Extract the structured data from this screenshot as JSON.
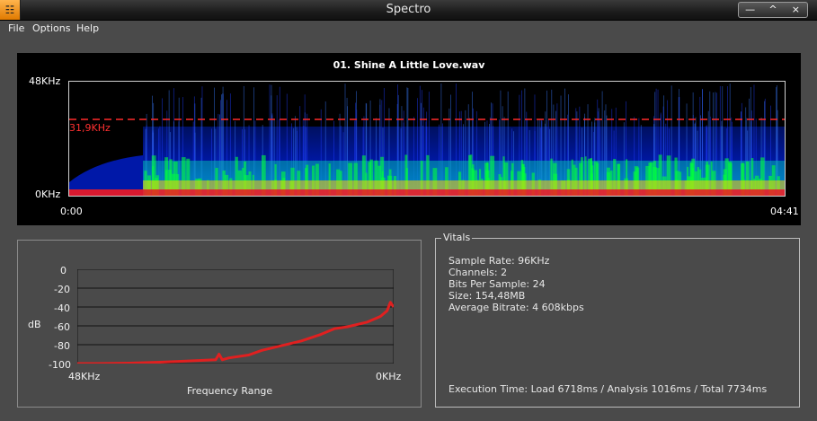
{
  "window": {
    "title": "Spectro",
    "icon": "app-icon",
    "buttons": {
      "minimize": "—",
      "maximize": "^",
      "close": "×"
    }
  },
  "menu": {
    "file": "File",
    "options": "Options",
    "help": "Help"
  },
  "spectrogram": {
    "file_name": "01. Shine A Little Love.wav",
    "freq_top": "48KHz",
    "freq_bottom": "0KHz",
    "cutoff_label": "31,9KHz",
    "time_start": "0:00",
    "time_end": "04:41",
    "colors": {
      "cutoff": "#ff2a2a",
      "low": "#0018a8",
      "mid": "#00ff3c",
      "high": "#ffd000",
      "peak": "#ff1a1a"
    }
  },
  "chart_data": {
    "type": "line",
    "xlabel": "Frequency Range",
    "ylabel": "dB",
    "x_tick_labels": [
      "48KHz",
      "0KHz"
    ],
    "y_ticks": [
      0,
      -20,
      -40,
      -60,
      -80,
      -100
    ],
    "ylim": [
      -100,
      0
    ],
    "xlim": [
      48,
      0
    ],
    "grid": true,
    "series": [
      {
        "color": "#e02020",
        "x": [
          48,
          45,
          40,
          35,
          30,
          27,
          26.5,
          26,
          25,
          22,
          20,
          17,
          14,
          11,
          9,
          7,
          4,
          2,
          1,
          0.5,
          0
        ],
        "y": [
          -100,
          -100,
          -99.5,
          -98.5,
          -97,
          -96,
          -90,
          -96,
          -94,
          -91,
          -86,
          -81,
          -76,
          -69,
          -63,
          -61,
          -56,
          -50,
          -44,
          -35,
          -40
        ]
      }
    ]
  },
  "vitals": {
    "legend": "Vitals",
    "sample_rate": "Sample Rate: 96KHz",
    "channels": "Channels: 2",
    "bits_per_sample": "Bits Per Sample: 24",
    "size": "Size: 154,48MB",
    "average_bitrate": "Average Bitrate: 4 608kbps",
    "execution_time": "Execution Time: Load 6718ms / Analysis 1016ms / Total 7734ms"
  }
}
